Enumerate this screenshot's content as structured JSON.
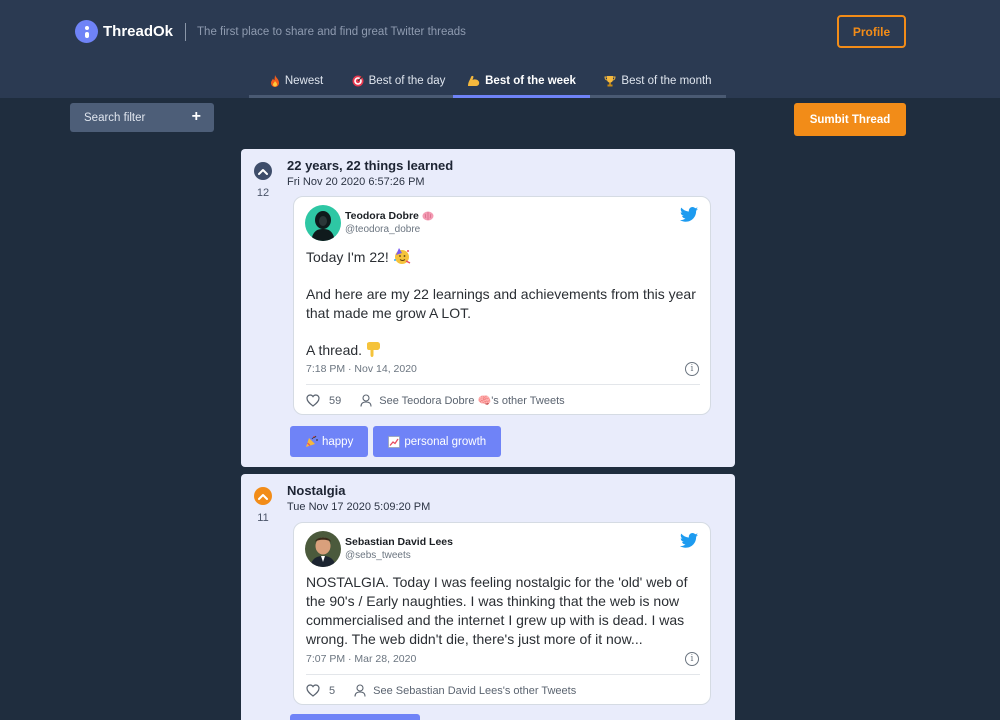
{
  "header": {
    "app_name": "ThreadOk",
    "tagline": "The first place to share and find great Twitter threads",
    "profile_label": "Profile"
  },
  "tabs": [
    {
      "label": "Newest",
      "icon": "fire-icon"
    },
    {
      "label": "Best of the day",
      "icon": "target-icon"
    },
    {
      "label": "Best of the week",
      "icon": "flexed-biceps-icon",
      "active": true
    },
    {
      "label": "Best of the month",
      "icon": "trophy-icon"
    }
  ],
  "search": {
    "label": "Search filter",
    "plus": "+"
  },
  "submit_label": "Sumbit Thread",
  "threads": [
    {
      "votes": "12",
      "title": "22 years, 22 things learned",
      "date": "Fri Nov 20 2020 6:57:26 PM",
      "tweet": {
        "name": "Teodora Dobre",
        "handle": "@teodora_dobre",
        "text": [
          "Today I'm 22!",
          "And here are my 22 learnings and achievements from this year that made me grow A LOT.",
          "A thread."
        ],
        "time": "7:18 PM · Nov 14, 2020",
        "likes": "59",
        "other": "See Teodora Dobre 🧠's other Tweets"
      },
      "tags": [
        "happy",
        "personal growth"
      ]
    },
    {
      "votes": "11",
      "title": "Nostalgia",
      "date": "Tue Nov 17 2020 5:09:20 PM",
      "tweet": {
        "name": "Sebastian David Lees",
        "handle": "@sebs_tweets",
        "text": "NOSTALGIA. Today I was feeling nostalgic for the 'old' web of the 90's / Early naughties. I was thinking that the web is now commercialised and the internet I grew up with is dead. I was wrong. The web didn't die, there's just more of it now...",
        "time": "7:07 PM · Mar 28, 2020",
        "likes": "5",
        "other": "See Sebastian David Lees's other Tweets"
      }
    }
  ],
  "colors": {
    "background": "#1f2d3e",
    "header": "#2b3a52",
    "accent_orange": "#f28c18",
    "accent_blue": "#6f83f7",
    "card": "#e9ecfb",
    "twitter_blue": "#1d9bf0"
  }
}
